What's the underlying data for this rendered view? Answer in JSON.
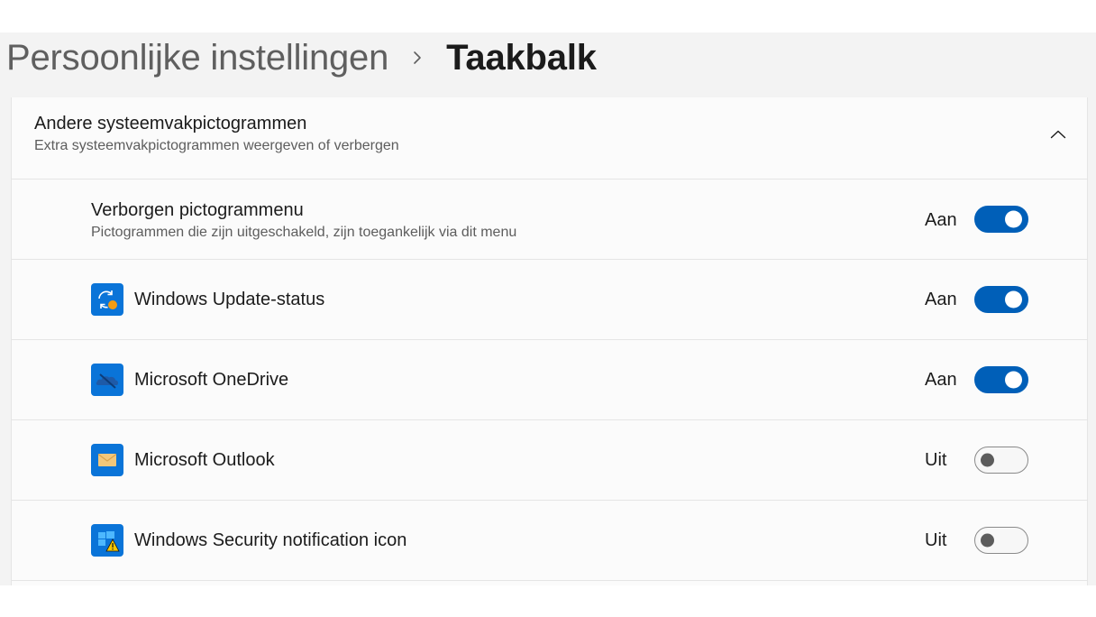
{
  "breadcrumb": {
    "parent": "Persoonlijke instellingen",
    "current": "Taakbalk"
  },
  "section": {
    "title": "Andere systeemvakpictogrammen",
    "subtitle": "Extra systeemvakpictogrammen weergeven of verbergen",
    "collapse_icon": "chevron-up-icon"
  },
  "hidden_menu": {
    "title": "Verborgen pictogrammenu",
    "subtitle": "Pictogrammen die zijn uitgeschakeld, zijn toegankelijk via dit menu",
    "state": "Aan",
    "on": true
  },
  "items": [
    {
      "label": "Windows Update-status",
      "icon": "windows-update-icon",
      "state": "Aan",
      "on": true
    },
    {
      "label": "Microsoft OneDrive",
      "icon": "onedrive-icon",
      "state": "Aan",
      "on": true
    },
    {
      "label": "Microsoft Outlook",
      "icon": "outlook-icon",
      "state": "Uit",
      "on": false
    },
    {
      "label": "Windows Security notification icon",
      "icon": "windows-security-icon",
      "state": "Uit",
      "on": false
    }
  ],
  "colors": {
    "accent": "#005fb8",
    "background": "#f3f3f3",
    "card": "#fbfbfb",
    "icon_tile": "#0a74d8",
    "update_dot": "#f39c12",
    "outlook_envelope": "#f2c77a",
    "warning": "#f7c600"
  }
}
